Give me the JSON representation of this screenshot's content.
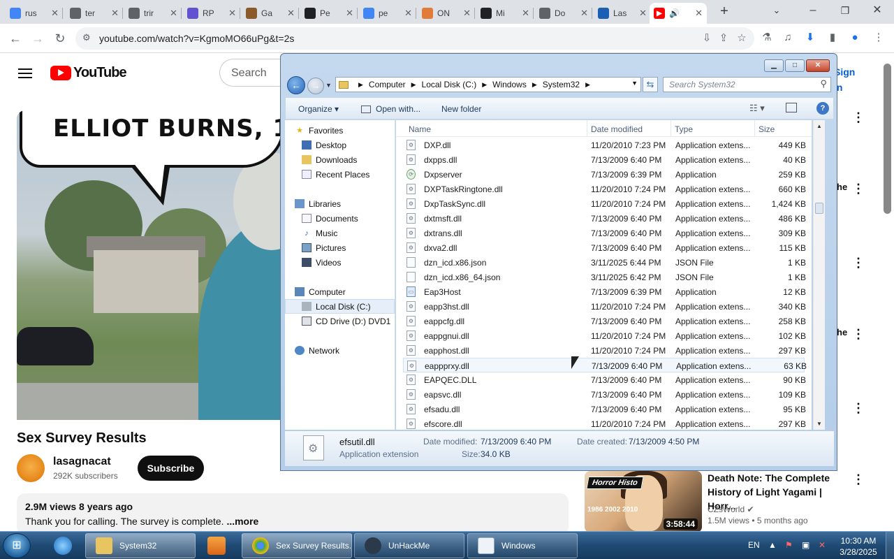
{
  "browser": {
    "tabs": [
      {
        "title": "rus",
        "color": "#4285f4"
      },
      {
        "title": "ter",
        "color": "#5f6368"
      },
      {
        "title": "trir",
        "color": "#5f6368"
      },
      {
        "title": "RP",
        "color": "#6152d1"
      },
      {
        "title": "Ga",
        "color": "#8b5a2b"
      },
      {
        "title": "Pe",
        "color": "#202124"
      },
      {
        "title": "pe",
        "color": "#4285f4"
      },
      {
        "title": "ON",
        "color": "#e07b39"
      },
      {
        "title": "Mi",
        "color": "#202124"
      },
      {
        "title": "Do",
        "color": "#5f6368"
      },
      {
        "title": "Las",
        "color": "#1a5fb4"
      }
    ],
    "active_tab_icon": "youtube-favicon",
    "new_tab": "+",
    "url": "youtube.com/watch?v=KgmoMO66uPg&t=2s"
  },
  "youtube": {
    "logo": "YouTube",
    "search_placeholder": "Search",
    "sign_in": "Sign in",
    "video_caption": "ELLIOT BURNS, 1",
    "title": "Sex Survey Results",
    "channel": "lasagnacat",
    "subscribers": "292K subscribers",
    "subscribe": "Subscribe",
    "views": "2.9M views  8 years ago",
    "description": "Thank you for calling. The survey is complete. ",
    "more": "...more",
    "side_fragments": [
      "he",
      "he"
    ],
    "recommended": {
      "title": "Death Note: The Complete History of Light Yagami | Horr...",
      "channel": "CZsWorld",
      "meta": "1.5M views • 5 months ago",
      "duration": "3:58:44",
      "thumb_label": "Horror Histo",
      "thumb_years": "1986  2002  2010"
    }
  },
  "explorer": {
    "breadcrumb": [
      "Computer",
      "Local Disk (C:)",
      "Windows",
      "System32"
    ],
    "search_placeholder": "Search System32",
    "commands": {
      "organize": "Organize ▾",
      "open_with": "Open with...",
      "new_folder": "New folder"
    },
    "nav": {
      "favorites": "Favorites",
      "desktop": "Desktop",
      "downloads": "Downloads",
      "recent": "Recent Places",
      "libraries": "Libraries",
      "documents": "Documents",
      "music": "Music",
      "pictures": "Pictures",
      "videos": "Videos",
      "computer": "Computer",
      "local_disk": "Local Disk (C:)",
      "cd_drive": "CD Drive (D:) DVD1",
      "network": "Network"
    },
    "columns": {
      "name": "Name",
      "date": "Date modified",
      "type": "Type",
      "size": "Size"
    },
    "files": [
      {
        "name": "DXP.dll",
        "date": "11/20/2010 7:23 PM",
        "type": "Application extens...",
        "size": "449 KB",
        "icon": "dll"
      },
      {
        "name": "dxpps.dll",
        "date": "7/13/2009 6:40 PM",
        "type": "Application extens...",
        "size": "40 KB",
        "icon": "dll"
      },
      {
        "name": "Dxpserver",
        "date": "7/13/2009 6:39 PM",
        "type": "Application",
        "size": "259 KB",
        "icon": "gear"
      },
      {
        "name": "DXPTaskRingtone.dll",
        "date": "11/20/2010 7:24 PM",
        "type": "Application extens...",
        "size": "660 KB",
        "icon": "dll"
      },
      {
        "name": "DxpTaskSync.dll",
        "date": "11/20/2010 7:24 PM",
        "type": "Application extens...",
        "size": "1,424 KB",
        "icon": "dll"
      },
      {
        "name": "dxtmsft.dll",
        "date": "7/13/2009 6:40 PM",
        "type": "Application extens...",
        "size": "486 KB",
        "icon": "dll"
      },
      {
        "name": "dxtrans.dll",
        "date": "7/13/2009 6:40 PM",
        "type": "Application extens...",
        "size": "309 KB",
        "icon": "dll"
      },
      {
        "name": "dxva2.dll",
        "date": "7/13/2009 6:40 PM",
        "type": "Application extens...",
        "size": "115 KB",
        "icon": "dll"
      },
      {
        "name": "dzn_icd.x86.json",
        "date": "3/11/2025 6:44 PM",
        "type": "JSON File",
        "size": "1 KB",
        "icon": "file"
      },
      {
        "name": "dzn_icd.x86_64.json",
        "date": "3/11/2025 6:42 PM",
        "type": "JSON File",
        "size": "1 KB",
        "icon": "file"
      },
      {
        "name": "Eap3Host",
        "date": "7/13/2009 6:39 PM",
        "type": "Application",
        "size": "12 KB",
        "icon": "app"
      },
      {
        "name": "eapp3hst.dll",
        "date": "11/20/2010 7:24 PM",
        "type": "Application extens...",
        "size": "340 KB",
        "icon": "dll"
      },
      {
        "name": "eappcfg.dll",
        "date": "7/13/2009 6:40 PM",
        "type": "Application extens...",
        "size": "258 KB",
        "icon": "dll"
      },
      {
        "name": "eappgnui.dll",
        "date": "11/20/2010 7:24 PM",
        "type": "Application extens...",
        "size": "102 KB",
        "icon": "dll"
      },
      {
        "name": "eapphost.dll",
        "date": "11/20/2010 7:24 PM",
        "type": "Application extens...",
        "size": "297 KB",
        "icon": "dll"
      },
      {
        "name": "eappprxy.dll",
        "date": "7/13/2009 6:40 PM",
        "type": "Application extens...",
        "size": "63 KB",
        "icon": "dll",
        "hover": true
      },
      {
        "name": "EAPQEC.DLL",
        "date": "7/13/2009 6:40 PM",
        "type": "Application extens...",
        "size": "90 KB",
        "icon": "dll"
      },
      {
        "name": "eapsvc.dll",
        "date": "7/13/2009 6:40 PM",
        "type": "Application extens...",
        "size": "109 KB",
        "icon": "dll"
      },
      {
        "name": "efsadu.dll",
        "date": "7/13/2009 6:40 PM",
        "type": "Application extens...",
        "size": "95 KB",
        "icon": "dll"
      },
      {
        "name": "efscore.dll",
        "date": "11/20/2010 7:24 PM",
        "type": "Application extens...",
        "size": "297 KB",
        "icon": "dll"
      }
    ],
    "details": {
      "name": "efsutil.dll",
      "type": "Application extension",
      "modified_label": "Date modified:",
      "modified": "7/13/2009 6:40 PM",
      "created_label": "Date created:",
      "created": "7/13/2009 4:50 PM",
      "size_label": "Size:",
      "size": "34.0 KB"
    }
  },
  "taskbar": {
    "buttons": [
      "System32",
      "Sex Survey Results...",
      "UnHackMe",
      "Windows"
    ],
    "lang": "EN",
    "time": "10:30 AM",
    "date": "3/28/2025"
  }
}
